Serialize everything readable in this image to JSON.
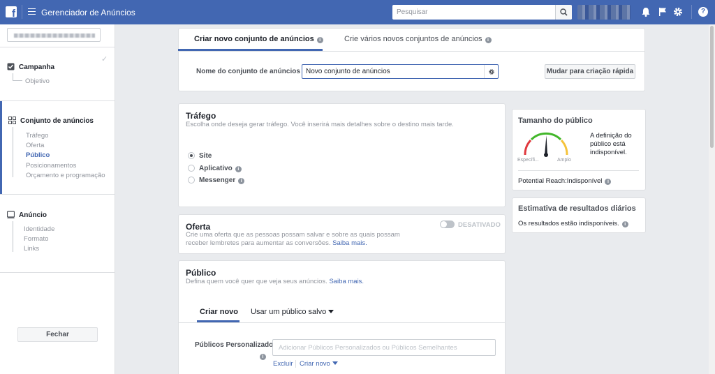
{
  "topbar": {
    "app_title": "Gerenciador de Anúncios",
    "search_placeholder": "Pesquisar",
    "help_label": "?"
  },
  "sidebar": {
    "campaign": {
      "label": "Campanha",
      "items": [
        "Objetivo"
      ]
    },
    "adset": {
      "label": "Conjunto de anúncios",
      "items": [
        "Tráfego",
        "Oferta",
        "Público",
        "Posicionamentos",
        "Orçamento e programação"
      ],
      "active_item": "Público"
    },
    "ad": {
      "label": "Anúncio",
      "items": [
        "Identidade",
        "Formato",
        "Links"
      ]
    },
    "close_label": "Fechar"
  },
  "header_card": {
    "tabs": [
      "Criar novo conjunto de anúncios",
      "Crie vários novos conjuntos de anúncios"
    ],
    "name_label": "Nome do conjunto de anúncios",
    "name_value": "Novo conjunto de anúncios",
    "quick_create_label": "Mudar para criação rápida"
  },
  "traffic": {
    "title": "Tráfego",
    "subtitle": "Escolha onde deseja gerar tráfego. Você inserirá mais detalhes sobre o destino mais tarde.",
    "options": [
      "Site",
      "Aplicativo",
      "Messenger"
    ],
    "selected": "Site"
  },
  "offer": {
    "title": "Oferta",
    "subtitle": "Crie uma oferta que as pessoas possam salvar e sobre as quais possam receber lembretes para aumentar as conversões.",
    "learn_more": "Saiba mais.",
    "toggle_label": "DESATIVADO"
  },
  "audience": {
    "title": "Público",
    "subtitle": "Defina quem você quer que veja seus anúncios.",
    "learn_more": "Saiba mais.",
    "tabs": [
      "Criar novo",
      "Usar um público salvo"
    ],
    "custom_label": "Públicos Personalizados",
    "custom_placeholder": "Adicionar Públicos Personalizados ou Públicos Semelhantes",
    "exclude_label": "Excluir",
    "create_new_label": "Criar novo"
  },
  "audience_size": {
    "title": "Tamanho do público",
    "message": "A definição do público está indisponível.",
    "gauge_left": "Específi...",
    "gauge_right": "Amplo",
    "reach_label": "Potential Reach:Indisponível"
  },
  "daily_results": {
    "title": "Estimativa de resultados diários",
    "message": "Os resultados estão indisponíveis."
  }
}
